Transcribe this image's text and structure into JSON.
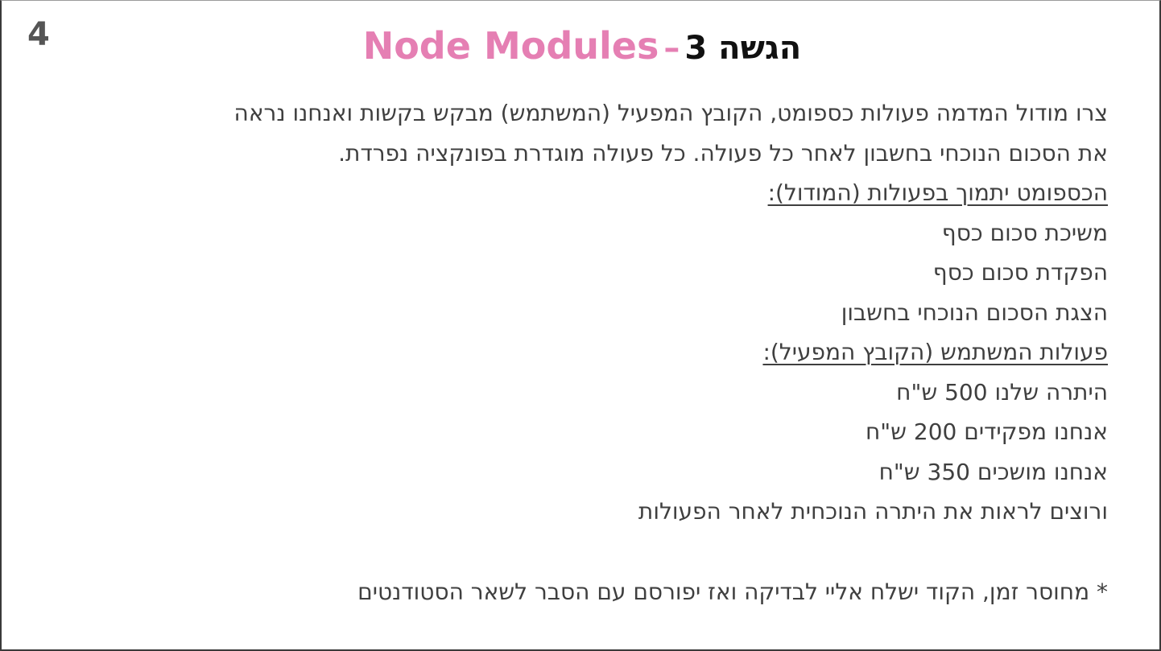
{
  "slide": {
    "number": "4",
    "title_hebrew": "הגשה 3",
    "title_separator": "–",
    "title_english": "Node Modules"
  },
  "body": {
    "intro_line_1": "צרו מודול המדמה פעולות כספומט, הקובץ המפעיל (המשתמש) מבקש בקשות ואנחנו נראה",
    "intro_line_2": "את הסכום הנוכחי בחשבון לאחר כל פעולה. כל פעולה מוגדרת בפונקציה נפרדת.",
    "module_heading": "הכספומט יתמוך בפעולות (המודול):",
    "module_actions": [
      "משיכת סכום כסף",
      "הפקדת סכום כסף",
      "הצגת הסכום הנוכחי בחשבון"
    ],
    "user_heading": "פעולות המשתמש (הקובץ המפעיל):",
    "user_actions": [
      "היתרה שלנו 500 ש\"ח",
      "אנחנו מפקידים 200 ש\"ח",
      "אנחנו מושכים 350 ש\"ח",
      "ורוצים לראות את היתרה הנוכחית לאחר הפעולות"
    ],
    "footnote": "* מחוסר זמן, הקוד ישלח אליי לבדיקה ואז יפורסם עם הסבר לשאר הסטודנטים"
  }
}
